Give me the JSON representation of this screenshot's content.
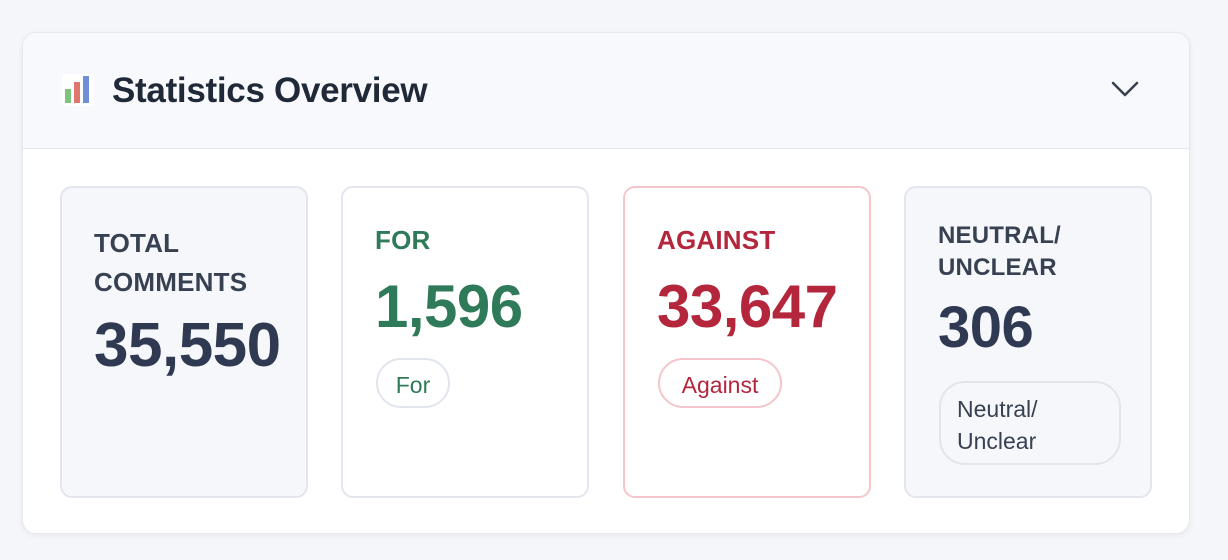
{
  "header": {
    "title": "Statistics Overview",
    "icon": "bar-chart-icon",
    "collapse_icon": "chevron-down-icon"
  },
  "stats": {
    "total": {
      "label": "TOTAL\nCOMMENTS",
      "value": "35,550"
    },
    "for": {
      "label": "FOR",
      "value": "1,596",
      "badge": "For",
      "color": "#2f7a58"
    },
    "against": {
      "label": "AGAINST",
      "value": "33,647",
      "badge": "Against",
      "color": "#b3263c"
    },
    "neutral": {
      "label": "NEUTRAL/\nUNCLEAR",
      "value": "306",
      "badge": "Neutral/\nUnclear",
      "color": "#374151"
    }
  }
}
